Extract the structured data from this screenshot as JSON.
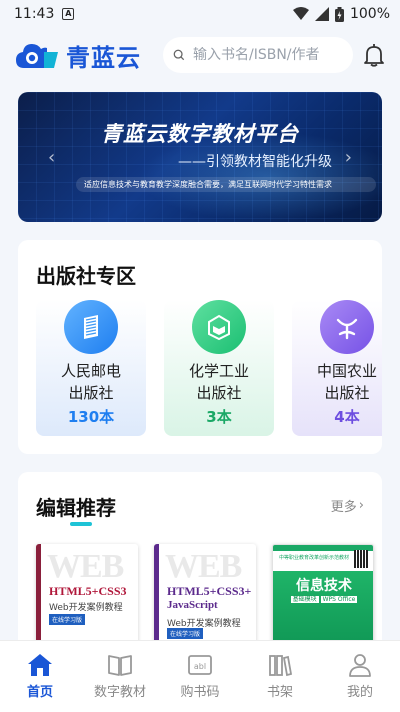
{
  "status_bar": {
    "time": "11:43",
    "battery": "100%"
  },
  "header": {
    "logo_text": "青蓝云",
    "search_placeholder": "输入书名/ISBN/作者"
  },
  "banner": {
    "title": "青蓝云数字教材平台",
    "subtitle": "——引领教材智能化升级",
    "note": "适应信息技术与教育教学深度融合需要，满足互联网时代学习特性需求",
    "slide_count": 4,
    "active_slide": 1
  },
  "publishers": {
    "title": "出版社专区",
    "items": [
      {
        "name": "人民邮电出版社",
        "count": "130本",
        "color": "#1e7ef0"
      },
      {
        "name": "化学工业出版社",
        "count": "3本",
        "color": "#1aa866"
      },
      {
        "name": "中国农业出版社",
        "count": "4本",
        "color": "#6d4ee0"
      }
    ]
  },
  "recommend": {
    "title": "编辑推荐",
    "more": "更多",
    "books": [
      {
        "cover_word": "WEB",
        "title": "HTML5+CSS3",
        "subtitle": "Web开发案例教程",
        "tag": "在线学习版"
      },
      {
        "cover_word": "WEB",
        "title": "HTML5+CSS3+",
        "extra": "JavaScript",
        "subtitle": "Web开发案例教程",
        "tag": "在线学习版"
      },
      {
        "top_text": "中等职业教育改革创新示范教材",
        "title": "信息技术",
        "subtitle_a": "基础模块",
        "subtitle_b": "WPS Office"
      }
    ]
  },
  "tabbar": {
    "items": [
      {
        "label": "首页",
        "active": true
      },
      {
        "label": "数字教材",
        "active": false
      },
      {
        "label": "购书码",
        "active": false
      },
      {
        "label": "书架",
        "active": false
      },
      {
        "label": "我的",
        "active": false
      }
    ]
  },
  "colors": {
    "brand": "#1a56d6",
    "accent": "#1ec3d6"
  }
}
